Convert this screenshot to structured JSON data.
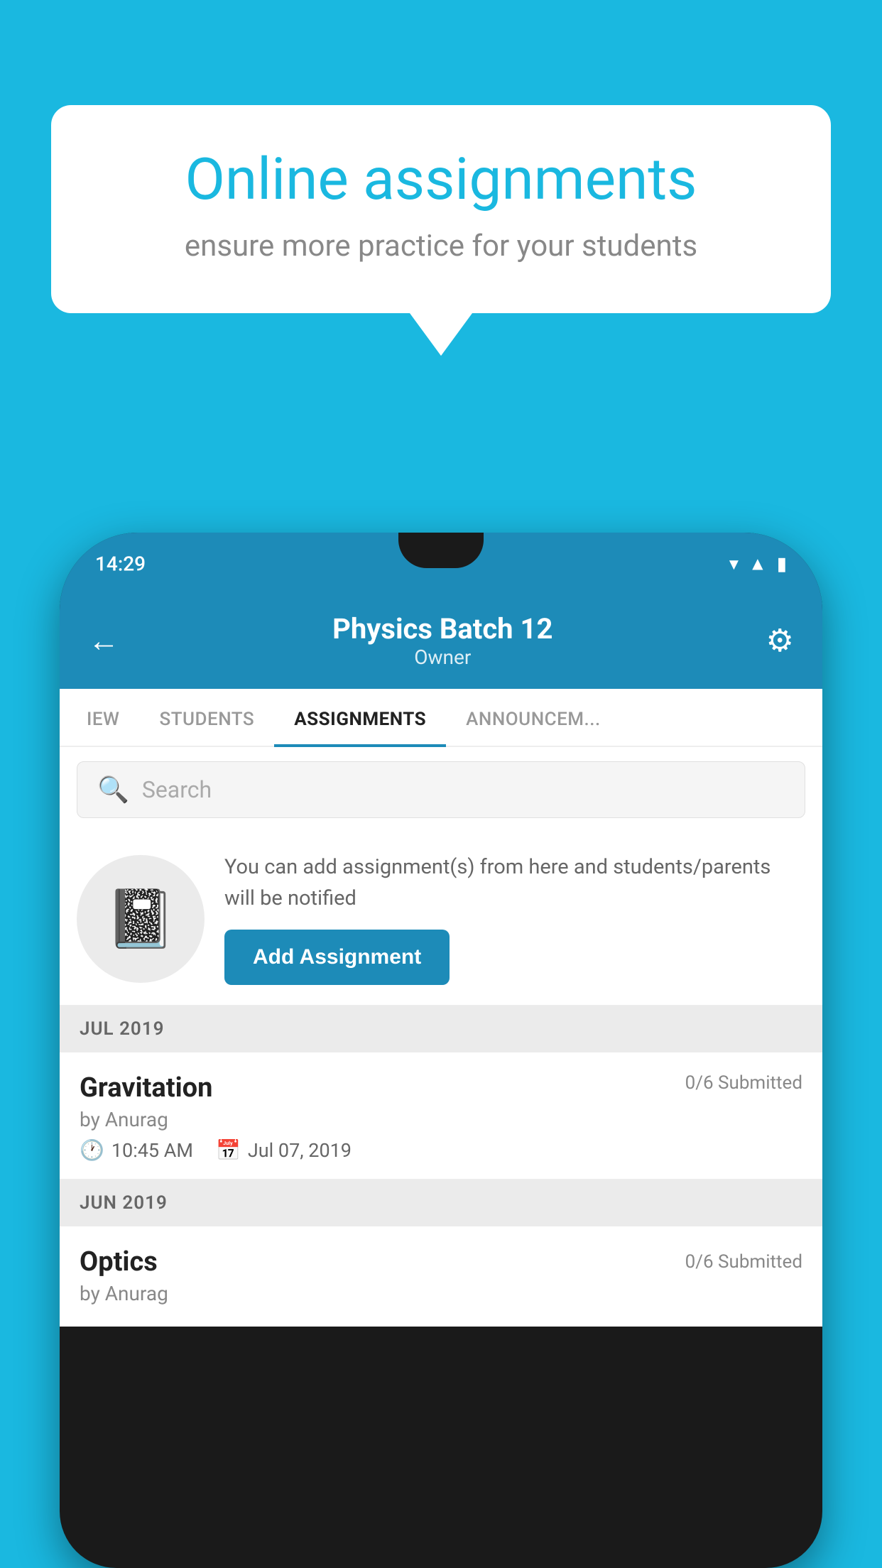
{
  "background_color": "#1ab8e0",
  "speech_bubble": {
    "title": "Online assignments",
    "subtitle": "ensure more practice for your students"
  },
  "phone": {
    "status_bar": {
      "time": "14:29",
      "icons": [
        "wifi",
        "signal",
        "battery"
      ]
    },
    "header": {
      "title": "Physics Batch 12",
      "subtitle": "Owner",
      "back_label": "←",
      "gear_label": "⚙"
    },
    "tabs": [
      {
        "label": "IEW",
        "active": false
      },
      {
        "label": "STUDENTS",
        "active": false
      },
      {
        "label": "ASSIGNMENTS",
        "active": true
      },
      {
        "label": "ANNOUNCEM...",
        "active": false
      }
    ],
    "search": {
      "placeholder": "Search"
    },
    "promo": {
      "text": "You can add assignment(s) from here and students/parents will be notified",
      "button_label": "Add Assignment"
    },
    "sections": [
      {
        "month": "JUL 2019",
        "assignments": [
          {
            "title": "Gravitation",
            "submitted": "0/6 Submitted",
            "author": "by Anurag",
            "time": "10:45 AM",
            "date": "Jul 07, 2019"
          }
        ]
      },
      {
        "month": "JUN 2019",
        "assignments": [
          {
            "title": "Optics",
            "submitted": "0/6 Submitted",
            "author": "by Anurag"
          }
        ]
      }
    ]
  }
}
